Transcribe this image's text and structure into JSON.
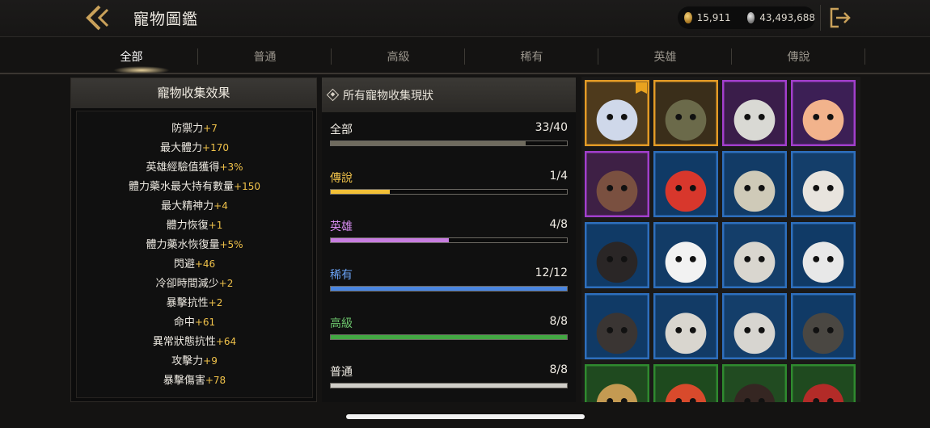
{
  "header": {
    "title": "寵物圖鑑",
    "gold": "15,911",
    "silver": "43,493,688"
  },
  "tabs": [
    {
      "label": "全部",
      "active": true
    },
    {
      "label": "普通",
      "active": false
    },
    {
      "label": "高級",
      "active": false
    },
    {
      "label": "稀有",
      "active": false
    },
    {
      "label": "英雄",
      "active": false
    },
    {
      "label": "傳說",
      "active": false
    }
  ],
  "collection_effects": {
    "title": "寵物收集效果",
    "stats": [
      {
        "name": "防禦力",
        "value": "+7"
      },
      {
        "name": "最大體力",
        "value": "+170"
      },
      {
        "name": "英雄經驗值獲得",
        "value": "+3%"
      },
      {
        "name": "體力藥水最大持有數量",
        "value": "+150"
      },
      {
        "name": "最大精神力",
        "value": "+4"
      },
      {
        "name": "體力恢復",
        "value": "+1"
      },
      {
        "name": "體力藥水恢復量",
        "value": "+5%"
      },
      {
        "name": "閃避",
        "value": "+46"
      },
      {
        "name": "冷卻時間減少",
        "value": "+2"
      },
      {
        "name": "暴擊抗性",
        "value": "+2"
      },
      {
        "name": "命中",
        "value": "+61"
      },
      {
        "name": "異常狀態抗性",
        "value": "+64"
      },
      {
        "name": "攻擊力",
        "value": "+9"
      },
      {
        "name": "暴擊傷害",
        "value": "+78"
      }
    ]
  },
  "collection_status": {
    "title": "所有寵物收集現狀",
    "rows": [
      {
        "name": "全部",
        "count": "33/40",
        "progress": 0.825,
        "color": "#6f6b5e",
        "label_color": "#f0ece4"
      },
      {
        "name": "傳說",
        "count": "1/4",
        "progress": 0.25,
        "color": "#f2c037",
        "label_color": "#f0c24a"
      },
      {
        "name": "英雄",
        "count": "4/8",
        "progress": 0.5,
        "color": "#c77de0",
        "label_color": "#d68cf0"
      },
      {
        "name": "稀有",
        "count": "12/12",
        "progress": 1.0,
        "color": "#4a86e0",
        "label_color": "#6aa2f5"
      },
      {
        "name": "高級",
        "count": "8/8",
        "progress": 1.0,
        "color": "#43a843",
        "label_color": "#6cc56c"
      },
      {
        "name": "普通",
        "count": "8/8",
        "progress": 1.0,
        "color": "#d0cec8",
        "label_color": "#f0ece4"
      }
    ]
  },
  "pets": [
    {
      "name": "blue-white-dragon-pet",
      "frame": "#e39b26",
      "bg": "#4e3a1c",
      "badge": true
    },
    {
      "name": "armored-turtle-pet",
      "frame": "#e39b26",
      "bg": "#3a2e1a",
      "badge": false
    },
    {
      "name": "skeleton-pet",
      "frame": "#a23fcc",
      "bg": "#3a1d4a",
      "badge": false
    },
    {
      "name": "flower-cat-pet",
      "frame": "#a23fcc",
      "bg": "#3c1f55",
      "badge": false
    },
    {
      "name": "girl-doll-pet",
      "frame": "#a23fcc",
      "bg": "#3e2045",
      "badge": false
    },
    {
      "name": "red-parrot-pet",
      "frame": "#2e6fbd",
      "bg": "#103a66",
      "badge": false
    },
    {
      "name": "tiger-pet",
      "frame": "#2e6fbd",
      "bg": "#123b66",
      "badge": false
    },
    {
      "name": "white-cat-pet",
      "frame": "#2e6fbd",
      "bg": "#143e6a",
      "badge": false
    },
    {
      "name": "black-cat-pet",
      "frame": "#2e6fbd",
      "bg": "#103a66",
      "badge": false
    },
    {
      "name": "panda-pet",
      "frame": "#2e6fbd",
      "bg": "#123b66",
      "badge": false
    },
    {
      "name": "white-tiger-pet",
      "frame": "#2e6fbd",
      "bg": "#143e6a",
      "badge": false
    },
    {
      "name": "white-fox-pet",
      "frame": "#2e6fbd",
      "bg": "#103a66",
      "badge": false
    },
    {
      "name": "black-fox-pet",
      "frame": "#2e6fbd",
      "bg": "#103a66",
      "badge": false
    },
    {
      "name": "skull-red-eye-pet",
      "frame": "#2e6fbd",
      "bg": "#123b66",
      "badge": false
    },
    {
      "name": "skull-blue-eye-pet",
      "frame": "#2e6fbd",
      "bg": "#143e6a",
      "badge": false
    },
    {
      "name": "scarecrow-pet",
      "frame": "#2e6fbd",
      "bg": "#103a66",
      "badge": false
    },
    {
      "name": "straw-pet",
      "frame": "#2f8a2f",
      "bg": "#1f4a1f",
      "badge": false
    },
    {
      "name": "feather-pet",
      "frame": "#2f8a2f",
      "bg": "#1e4a1e",
      "badge": false
    },
    {
      "name": "dark-pet",
      "frame": "#2f8a2f",
      "bg": "#214b21",
      "badge": false
    },
    {
      "name": "red-devil-pet",
      "frame": "#2f8a2f",
      "bg": "#1f4a1f",
      "badge": false
    }
  ]
}
